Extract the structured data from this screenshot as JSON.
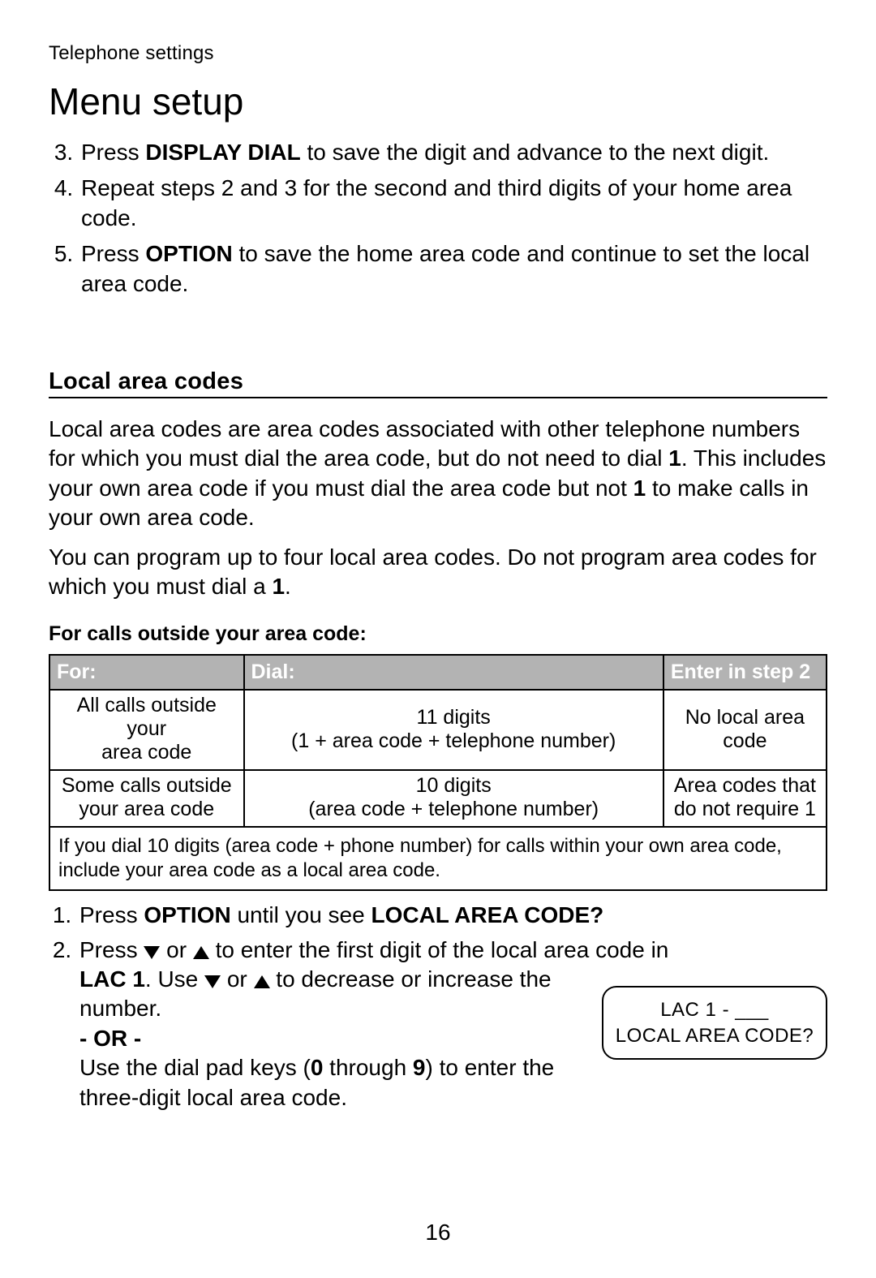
{
  "breadcrumb": "Telephone settings",
  "title": "Menu setup",
  "steps_top": [
    {
      "n": "3",
      "pre": "Press ",
      "bold": "DISPLAY DIAL",
      "post": " to save the digit and advance to the next digit."
    },
    {
      "n": "4",
      "text": "Repeat steps 2 and 3 for the second and third digits of your home area code."
    },
    {
      "n": "5",
      "pre": "Press ",
      "bold": "OPTION",
      "post": " to save the home area code and continue to set the local area code."
    }
  ],
  "section_heading": "Local area codes",
  "para1": {
    "t1": "Local area codes are area codes associated with other telephone numbers for which you must dial the area code, but do not need to dial ",
    "b1": "1",
    "t2": ". This includes your own area code if you must dial the area code but not ",
    "b2": "1",
    "t3": " to make calls in your own area code."
  },
  "para2": {
    "t1": "You can program up to four local area codes. Do not program area codes for which you must dial a ",
    "b1": "1",
    "t2": "."
  },
  "table_caption": "For calls outside your area code:",
  "table": {
    "headers": [
      "For:",
      "Dial:",
      "Enter in step 2"
    ],
    "rows": [
      {
        "for_l1": "All calls outside your",
        "for_l2": "area code",
        "dial_l1": "11 digits",
        "dial_l2": "(1 + area code + telephone number)",
        "enter_l1": "No local area",
        "enter_l2": "code"
      },
      {
        "for_l1": "Some calls outside",
        "for_l2": "your area code",
        "dial_l1": "10 digits",
        "dial_l2": "(area code + telephone number)",
        "enter_l1": "Area codes that",
        "enter_l2": "do not require 1"
      }
    ],
    "note": "If you dial 10 digits (area code + phone number) for calls within your own area code, include your area code as a local area code."
  },
  "steps_bottom": {
    "s1": {
      "pre": "Press ",
      "b1": "OPTION",
      "mid": " until you see ",
      "b2": "LOCAL AREA CODE?"
    },
    "s2": {
      "line1_pre": "Press ",
      "line1_mid": " or ",
      "line1_post": " to enter the first digit of the local area code in",
      "line2_b": "LAC 1",
      "line2_mid_a": ". Use ",
      "line2_mid_or": " or ",
      "line2_post": " to decrease or increase the number.",
      "or": "- OR -",
      "line3_pre": "Use the dial pad keys (",
      "line3_b1": "0",
      "line3_mid": " through ",
      "line3_b2": "9",
      "line3_post": ") to enter the three-digit local area code."
    }
  },
  "display": {
    "line1": "LAC 1 - ___",
    "line2": "LOCAL AREA CODE?"
  },
  "page_number": "16"
}
